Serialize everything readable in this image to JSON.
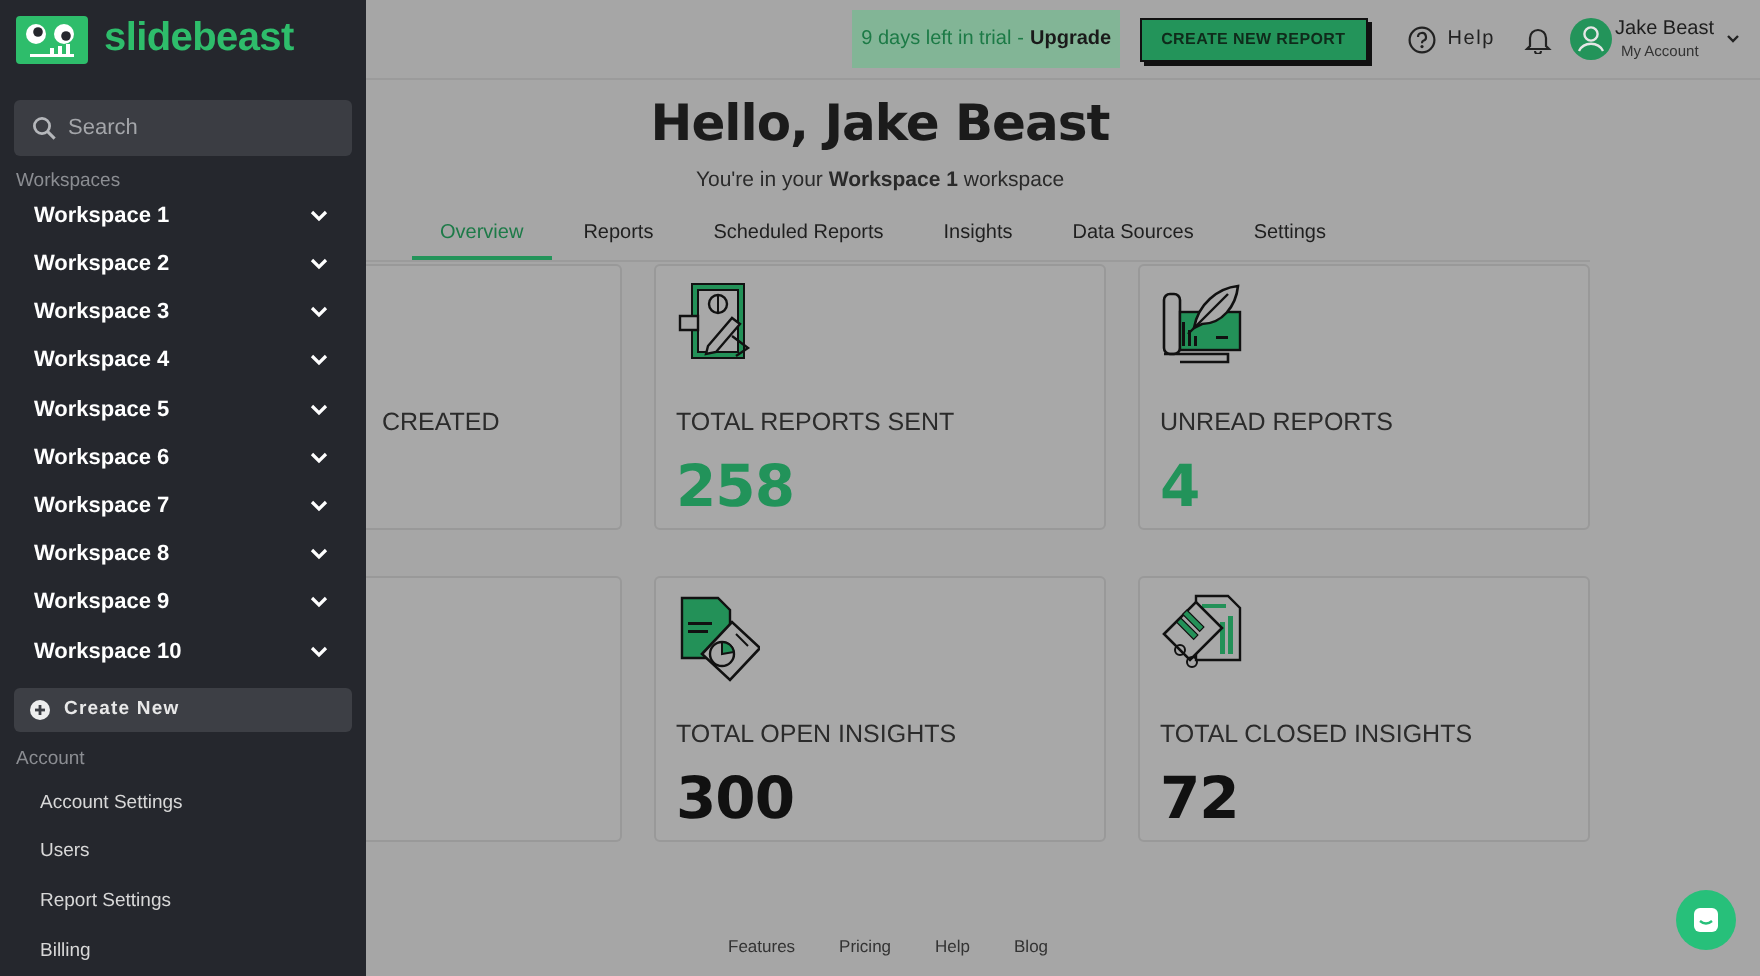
{
  "logo": {
    "text": "slidebeast"
  },
  "sidebar": {
    "search": {
      "placeholder": "Search"
    },
    "workspaces_label": "Workspaces",
    "workspaces": [
      {
        "label": "Workspace 1",
        "expanded": false
      },
      {
        "label": "Workspace 2",
        "expanded": false
      },
      {
        "label": "Workspace 3",
        "expanded": false
      },
      {
        "label": "Workspace 4",
        "expanded": false
      },
      {
        "label": "Workspace 5",
        "expanded": false
      },
      {
        "label": "Workspace 6",
        "expanded": false
      },
      {
        "label": "Workspace 7",
        "expanded": false
      },
      {
        "label": "Workspace 8",
        "expanded": false
      },
      {
        "label": "Workspace 9",
        "expanded": false
      },
      {
        "label": "Workspace 10",
        "expanded": false
      }
    ],
    "create_button": "Create New",
    "account_label": "Account",
    "account_items": [
      "Account Settings",
      "Users",
      "Report Settings",
      "Billing"
    ]
  },
  "header": {
    "trial": "9 days left in trial",
    "separator": "-",
    "upgrade": "Upgrade",
    "create_report": "CREATE NEW REPORT",
    "help": "Help",
    "user_name": "Jake Beast",
    "user_sub": "My Account"
  },
  "greeting": {
    "title": "Hello, Jake Beast",
    "subtitle": "You're in your **Workspace 1** workspace"
  },
  "tabs": [
    {
      "label": "Overview",
      "selected": true
    },
    {
      "label": "Reports",
      "selected": false
    },
    {
      "label": "Scheduled Reports",
      "selected": false
    },
    {
      "label": "Insights",
      "selected": false
    },
    {
      "label": "Data Sources",
      "selected": false
    },
    {
      "label": "Settings",
      "selected": false
    }
  ],
  "cards": [
    {
      "kind": "partial",
      "label": "CREATED"
    },
    {
      "kind": "sent",
      "label": "TOTAL REPORTS SENT",
      "value": "258",
      "accent": true
    },
    {
      "kind": "unread",
      "label": "UNREAD REPORTS",
      "value": "4",
      "accent": true
    },
    {
      "kind": "partial"
    },
    {
      "kind": "open",
      "label": "TOTAL OPEN INSIGHTS",
      "value": "300",
      "accent": false
    },
    {
      "kind": "closed",
      "label": "TOTAL CLOSED INSIGHTS",
      "value": "72",
      "accent": false
    }
  ],
  "footer": [
    "Features",
    "Pricing",
    "Help",
    "Blog"
  ]
}
